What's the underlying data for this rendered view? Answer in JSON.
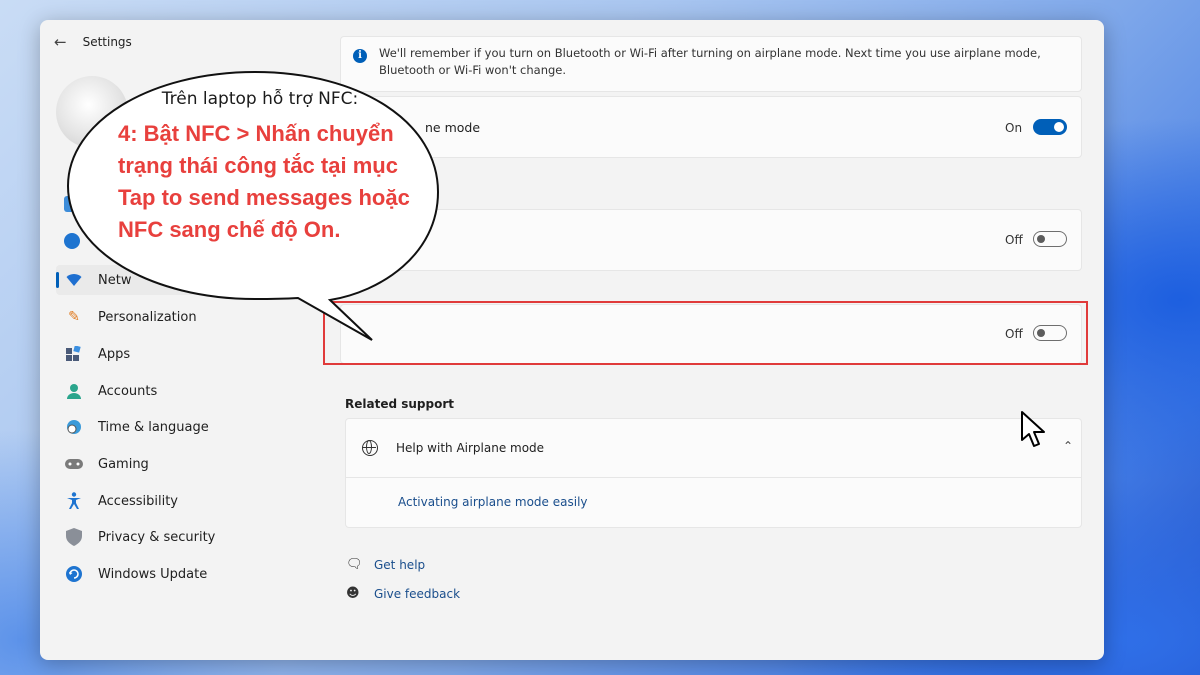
{
  "window": {
    "title": "Settings"
  },
  "sidebar": {
    "items": [
      {
        "label": "Network & internet",
        "shown_label": "Netw",
        "icon": "wifi-icon",
        "active": true
      },
      {
        "label": "Personalization",
        "icon": "brush-icon"
      },
      {
        "label": "Apps",
        "icon": "apps-icon"
      },
      {
        "label": "Accounts",
        "icon": "person-icon"
      },
      {
        "label": "Time & language",
        "icon": "clock-globe-icon"
      },
      {
        "label": "Gaming",
        "icon": "controller-icon"
      },
      {
        "label": "Accessibility",
        "icon": "accessibility-icon"
      },
      {
        "label": "Privacy & security",
        "icon": "shield-icon"
      },
      {
        "label": "Windows Update",
        "icon": "refresh-icon"
      }
    ]
  },
  "main": {
    "info": "We'll remember if you turn on Bluetooth or Wi-Fi after turning on airplane mode. Next time you use airplane mode, Bluetooth or Wi-Fi won't change.",
    "airplane_row": {
      "label_visible": "ne mode",
      "state": "On"
    },
    "row2": {
      "state": "Off"
    },
    "row3": {
      "state": "Off"
    },
    "related_support": {
      "title": "Related support",
      "item": "Help with Airplane mode",
      "link": "Activating airplane mode easily"
    },
    "footer": {
      "get_help": "Get help",
      "give_feedback": "Give feedback"
    }
  },
  "callout": {
    "intro": "Trên laptop hỗ trợ NFC:",
    "step": "4: Bật NFC > Nhấn chuyển trạng thái công tắc tại mục Tap to send messages hoặc NFC sang chế độ On."
  },
  "colors": {
    "accent": "#005fb8",
    "highlight_box": "#e03a3a",
    "callout_text": "#e8403d"
  }
}
